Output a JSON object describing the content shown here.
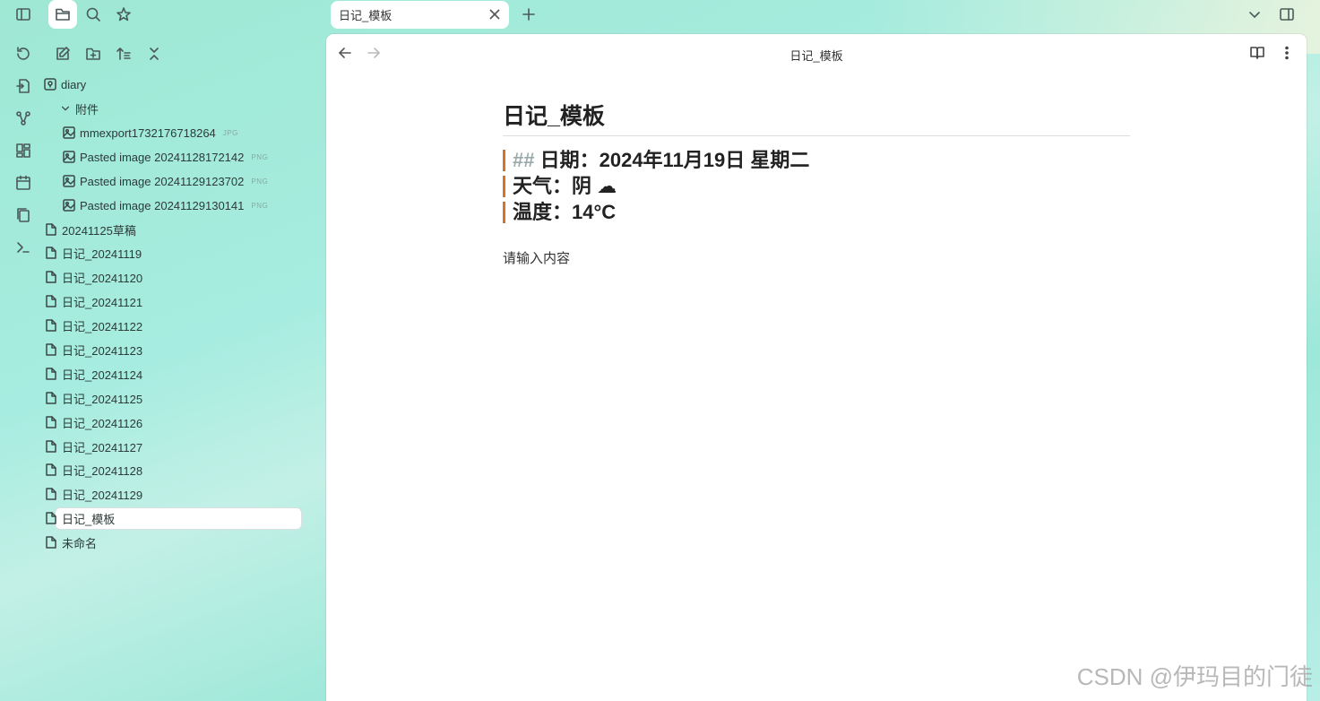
{
  "tab": {
    "title": "日记_模板"
  },
  "view": {
    "title": "日记_模板"
  },
  "tree": {
    "root": "diary",
    "folder": "附件",
    "attachments": [
      {
        "name": "mmexport1732176718264",
        "ext": "JPG"
      },
      {
        "name": "Pasted image 20241128172142",
        "ext": "PNG"
      },
      {
        "name": "Pasted image 20241129123702",
        "ext": "PNG"
      },
      {
        "name": "Pasted image 20241129130141",
        "ext": "PNG"
      }
    ],
    "files": [
      "20241125草稿",
      "日记_20241119",
      "日记_20241120",
      "日记_20241121",
      "日记_20241122",
      "日记_20241123",
      "日记_20241124",
      "日记_20241125",
      "日记_20241126",
      "日记_20241127",
      "日记_20241128",
      "日记_20241129",
      "日记_模板",
      "未命名"
    ]
  },
  "doc": {
    "title": "日记_模板",
    "line1_hash": "##",
    "line1": "日期：2024年11月19日 星期二",
    "line2": "天气：阴 ☁",
    "line3": "温度：14°C",
    "body": "请输入内容"
  },
  "watermark": "CSDN @伊玛目的门徒",
  "colors": {
    "accent_bar": "#d4742a",
    "background": "#a6ece0"
  }
}
